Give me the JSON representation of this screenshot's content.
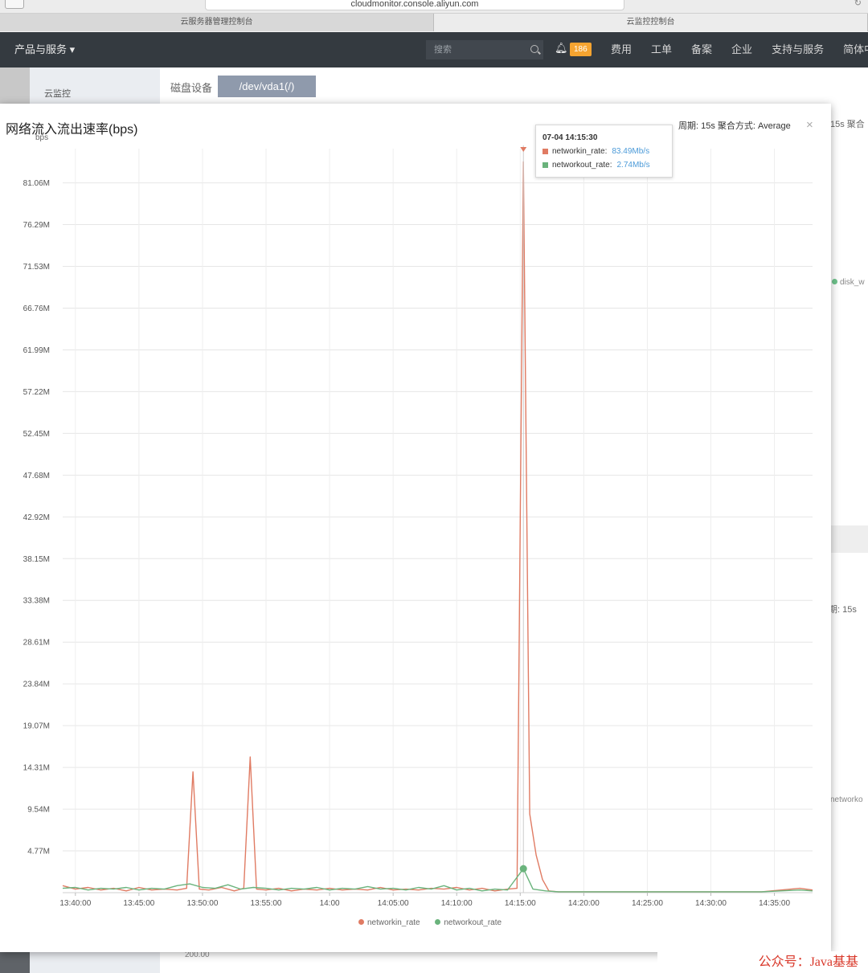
{
  "browser": {
    "url": "cloudmonitor.console.aliyun.com",
    "tabs": [
      "云服务器管理控制台",
      "云监控控制台"
    ]
  },
  "topnav": {
    "products": "产品与服务",
    "search_placeholder": "搜索",
    "notification_count": "186",
    "links": [
      "费用",
      "工单",
      "备案",
      "企业",
      "支持与服务",
      "简体中文"
    ]
  },
  "sidebar": {
    "item": "云监控"
  },
  "content": {
    "disk_label": "磁盘设备",
    "disk_value": "/dev/vda1(/)",
    "bg_period_a": "15s  聚合",
    "bg_legend_a": "disk_w",
    "bg_period_b": "期: 15s",
    "bg_legend_b": "networko",
    "bg_axis_tick": "200.00"
  },
  "modal": {
    "title": "网络流入流出速率(bps)",
    "period": "周期: 15s   聚合方式: Average",
    "close": "×",
    "tooltip": {
      "time": "07-04 14:15:30",
      "rows": [
        {
          "name": "networkin_rate:",
          "value": "83.49Mb/s",
          "color": "#e07b63"
        },
        {
          "name": "networkout_rate:",
          "value": "2.74Mb/s",
          "color": "#6ab37c"
        }
      ]
    }
  },
  "chart_data": {
    "type": "line",
    "title": "网络流入流出速率(bps)",
    "ylabel": "bps",
    "ylim": [
      0,
      85
    ],
    "y_ticks": [
      "4.77M",
      "9.54M",
      "14.31M",
      "19.07M",
      "23.84M",
      "28.61M",
      "33.38M",
      "38.15M",
      "42.92M",
      "47.68M",
      "52.45M",
      "57.22M",
      "61.99M",
      "66.76M",
      "71.53M",
      "76.29M",
      "81.06M"
    ],
    "x_ticks": [
      "13:40:00",
      "13:45:00",
      "13:50:00",
      "13:55:00",
      "14:00",
      "14:05:00",
      "14:10:00",
      "14:15:00",
      "14:20:00",
      "14:25:00",
      "14:30:00",
      "14:35:00"
    ],
    "x_range_minutes": [
      0,
      59
    ],
    "grid": true,
    "legend_position": "bottom",
    "series": [
      {
        "name": "networkin_rate",
        "color": "#e07b63",
        "unit": "Mbps",
        "points": [
          [
            0,
            0.8
          ],
          [
            1,
            0.4
          ],
          [
            2,
            0.6
          ],
          [
            3,
            0.3
          ],
          [
            4,
            0.5
          ],
          [
            5,
            0.2
          ],
          [
            6,
            0.6
          ],
          [
            7,
            0.3
          ],
          [
            8,
            0.4
          ],
          [
            9,
            0.3
          ],
          [
            9.75,
            0.5
          ],
          [
            10.25,
            13.8
          ],
          [
            10.75,
            0.4
          ],
          [
            11.5,
            0.3
          ],
          [
            12.5,
            0.6
          ],
          [
            13.5,
            0.2
          ],
          [
            14.25,
            0.5
          ],
          [
            14.75,
            15.5
          ],
          [
            15.25,
            0.4
          ],
          [
            16,
            0.3
          ],
          [
            17,
            0.5
          ],
          [
            18,
            0.2
          ],
          [
            19,
            0.4
          ],
          [
            20,
            0.3
          ],
          [
            21,
            0.5
          ],
          [
            22,
            0.3
          ],
          [
            23,
            0.4
          ],
          [
            24,
            0.3
          ],
          [
            25,
            0.6
          ],
          [
            26,
            0.3
          ],
          [
            27,
            0.4
          ],
          [
            28,
            0.3
          ],
          [
            29,
            0.5
          ],
          [
            30,
            0.4
          ],
          [
            31,
            0.6
          ],
          [
            32,
            0.3
          ],
          [
            33,
            0.5
          ],
          [
            34,
            0.2
          ],
          [
            35,
            0.4
          ],
          [
            35.75,
            0.5
          ],
          [
            36.25,
            83.49
          ],
          [
            36.75,
            9.0
          ],
          [
            37.25,
            4.3
          ],
          [
            37.75,
            1.5
          ],
          [
            38.25,
            0.2
          ],
          [
            39,
            0.1
          ],
          [
            45,
            0.1
          ],
          [
            50,
            0.1
          ],
          [
            55,
            0.1
          ],
          [
            58,
            0.5
          ],
          [
            59,
            0.3
          ]
        ]
      },
      {
        "name": "networkout_rate",
        "color": "#6ab37c",
        "unit": "Mbps",
        "points": [
          [
            0,
            0.5
          ],
          [
            1,
            0.6
          ],
          [
            2,
            0.3
          ],
          [
            3,
            0.5
          ],
          [
            4,
            0.4
          ],
          [
            5,
            0.6
          ],
          [
            6,
            0.3
          ],
          [
            7,
            0.5
          ],
          [
            8,
            0.4
          ],
          [
            9,
            0.8
          ],
          [
            10,
            1.0
          ],
          [
            11,
            0.6
          ],
          [
            12,
            0.5
          ],
          [
            13,
            0.9
          ],
          [
            14,
            0.4
          ],
          [
            15,
            0.6
          ],
          [
            16,
            0.5
          ],
          [
            17,
            0.3
          ],
          [
            18,
            0.5
          ],
          [
            19,
            0.4
          ],
          [
            20,
            0.6
          ],
          [
            21,
            0.3
          ],
          [
            22,
            0.5
          ],
          [
            23,
            0.4
          ],
          [
            24,
            0.7
          ],
          [
            25,
            0.4
          ],
          [
            26,
            0.5
          ],
          [
            27,
            0.3
          ],
          [
            28,
            0.6
          ],
          [
            29,
            0.4
          ],
          [
            30,
            0.8
          ],
          [
            31,
            0.3
          ],
          [
            32,
            0.5
          ],
          [
            33,
            0.2
          ],
          [
            34,
            0.4
          ],
          [
            35,
            0.3
          ],
          [
            36.25,
            2.74
          ],
          [
            37,
            0.4
          ],
          [
            38,
            0.2
          ],
          [
            39,
            0.1
          ],
          [
            45,
            0.1
          ],
          [
            50,
            0.1
          ],
          [
            55,
            0.1
          ],
          [
            58,
            0.3
          ],
          [
            59,
            0.2
          ]
        ]
      }
    ]
  },
  "footer": {
    "watermark": "公众号：Java基基"
  }
}
